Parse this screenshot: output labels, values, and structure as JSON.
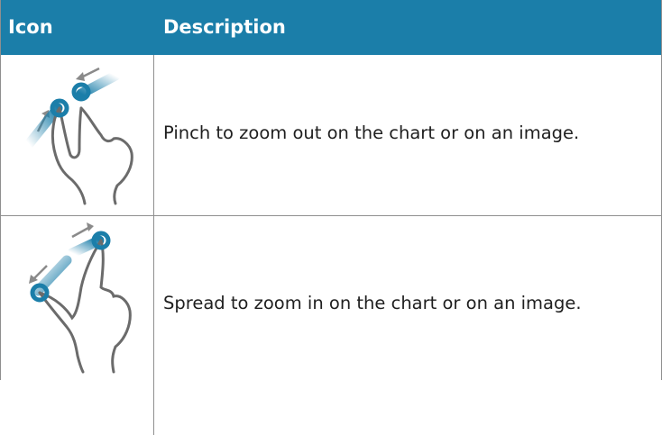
{
  "table": {
    "headers": {
      "icon": "Icon",
      "description": "Description"
    },
    "rows": [
      {
        "icon": "pinch-gesture-icon",
        "description": "Pinch to zoom out on the chart or on an image."
      },
      {
        "icon": "spread-gesture-icon",
        "description": "Spread to zoom in on the chart or on an image."
      }
    ]
  },
  "colors": {
    "header_background": "#1b7ea9",
    "gesture_blue": "#1b7ea9",
    "rule": "#8f8f8f"
  }
}
